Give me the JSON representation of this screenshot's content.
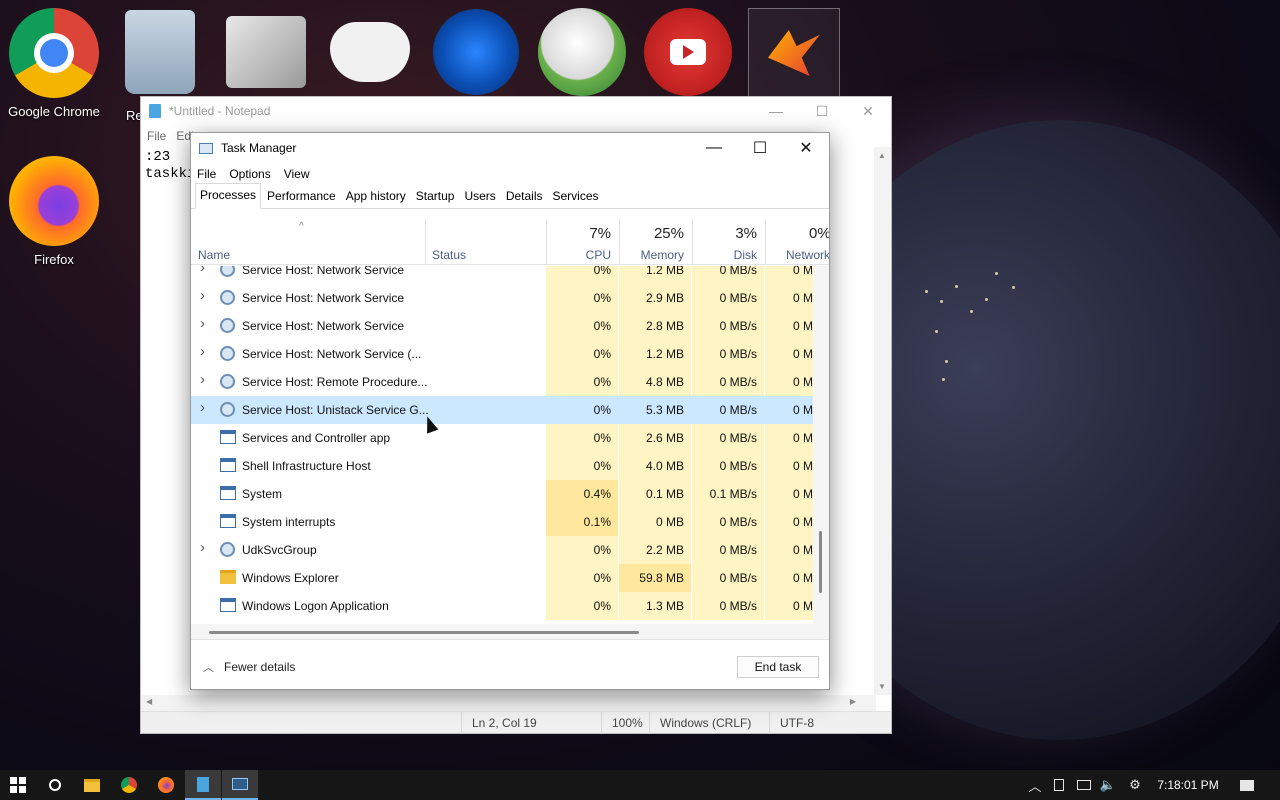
{
  "desktop": {
    "icons": [
      {
        "label": "Google Chrome"
      },
      {
        "label": "Re"
      },
      {
        "label": "Firefox"
      }
    ]
  },
  "notepad": {
    "title": "*Untitled - Notepad",
    "menu": [
      "File",
      "Edi"
    ],
    "text_lines": [
      ":23",
      "taskki"
    ],
    "status": {
      "position": "Ln 2, Col 19",
      "zoom": "100%",
      "line_ending": "Windows (CRLF)",
      "encoding": "UTF-8"
    }
  },
  "task_manager": {
    "title": "Task Manager",
    "menu": [
      "File",
      "Options",
      "View"
    ],
    "tabs": [
      "Processes",
      "Performance",
      "App history",
      "Startup",
      "Users",
      "Details",
      "Services"
    ],
    "active_tab": "Processes",
    "columns": {
      "name": "Name",
      "status": "Status",
      "cpu": {
        "pct": "7%",
        "label": "CPU"
      },
      "memory": {
        "pct": "25%",
        "label": "Memory"
      },
      "disk": {
        "pct": "3%",
        "label": "Disk"
      },
      "network": {
        "pct": "0%",
        "label": "Network"
      }
    },
    "rows": [
      {
        "name": "Service Host: Network Service",
        "cpu": "0%",
        "mem": "1.2 MB",
        "disk": "0 MB/s",
        "net": "0 M",
        "expand": true,
        "icon": "gear"
      },
      {
        "name": "Service Host: Network Service",
        "cpu": "0%",
        "mem": "2.9 MB",
        "disk": "0 MB/s",
        "net": "0 M",
        "expand": true,
        "icon": "gear"
      },
      {
        "name": "Service Host: Network Service",
        "cpu": "0%",
        "mem": "2.8 MB",
        "disk": "0 MB/s",
        "net": "0 M",
        "expand": true,
        "icon": "gear"
      },
      {
        "name": "Service Host: Network Service (...",
        "cpu": "0%",
        "mem": "1.2 MB",
        "disk": "0 MB/s",
        "net": "0 M",
        "expand": true,
        "icon": "gear"
      },
      {
        "name": "Service Host: Remote Procedure...",
        "cpu": "0%",
        "mem": "4.8 MB",
        "disk": "0 MB/s",
        "net": "0 M",
        "expand": true,
        "icon": "gear"
      },
      {
        "name": "Service Host: Unistack Service G...",
        "cpu": "0%",
        "mem": "5.3 MB",
        "disk": "0 MB/s",
        "net": "0 M",
        "expand": true,
        "icon": "gear",
        "highlight": true
      },
      {
        "name": "Services and Controller app",
        "cpu": "0%",
        "mem": "2.6 MB",
        "disk": "0 MB/s",
        "net": "0 M",
        "expand": false,
        "icon": "win"
      },
      {
        "name": "Shell Infrastructure Host",
        "cpu": "0%",
        "mem": "4.0 MB",
        "disk": "0 MB/s",
        "net": "0 M",
        "expand": false,
        "icon": "win"
      },
      {
        "name": "System",
        "cpu": "0.4%",
        "mem": "0.1 MB",
        "disk": "0.1 MB/s",
        "net": "0 M",
        "expand": false,
        "icon": "win"
      },
      {
        "name": "System interrupts",
        "cpu": "0.1%",
        "mem": "0 MB",
        "disk": "0 MB/s",
        "net": "0 M",
        "expand": false,
        "icon": "win"
      },
      {
        "name": "UdkSvcGroup",
        "cpu": "0%",
        "mem": "2.2 MB",
        "disk": "0 MB/s",
        "net": "0 M",
        "expand": true,
        "icon": "gear"
      },
      {
        "name": "Windows Explorer",
        "cpu": "0%",
        "mem": "59.8 MB",
        "disk": "0 MB/s",
        "net": "0 M",
        "expand": false,
        "icon": "folder"
      },
      {
        "name": "Windows Logon Application",
        "cpu": "0%",
        "mem": "1.3 MB",
        "disk": "0 MB/s",
        "net": "0 M",
        "expand": false,
        "icon": "win"
      }
    ],
    "fewer_details": "Fewer details",
    "end_task": "End task"
  },
  "taskbar": {
    "clock": "7:18:01 PM"
  },
  "colors": {
    "highlight_row": "#cce8ff",
    "heat_light": "#fff4c4",
    "heat_medium": "#ffe89e",
    "taskbar": "#161616"
  }
}
